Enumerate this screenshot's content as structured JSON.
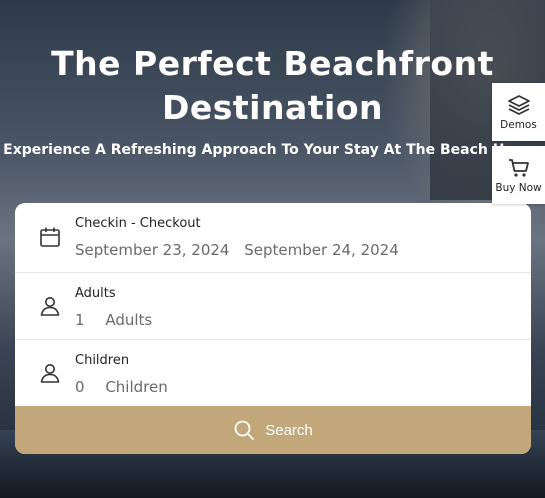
{
  "hero": {
    "title_line1": "The Perfect Beachfront",
    "title_line2": "Destination",
    "subtitle": "Experience A Refreshing Approach To Your Stay At The Beach House"
  },
  "side_panel": {
    "demos_label": "Demos",
    "buy_now_label": "Buy Now"
  },
  "booking": {
    "dates": {
      "label": "Checkin - Checkout",
      "checkin": "September 23, 2024",
      "checkout": "September 24, 2024"
    },
    "adults": {
      "label": "Adults",
      "count": "1",
      "unit": "Adults"
    },
    "children": {
      "label": "Children",
      "count": "0",
      "unit": "Children"
    },
    "search_label": "Search"
  },
  "colors": {
    "accent": "#c2a77b",
    "text_dark": "#222222",
    "text_muted": "#6a6a6a"
  },
  "icons": {
    "dates": "calendar-icon",
    "adults": "user-icon",
    "children": "user-icon",
    "demos": "layers-icon",
    "buy_now": "cart-icon",
    "search": "search-icon"
  }
}
